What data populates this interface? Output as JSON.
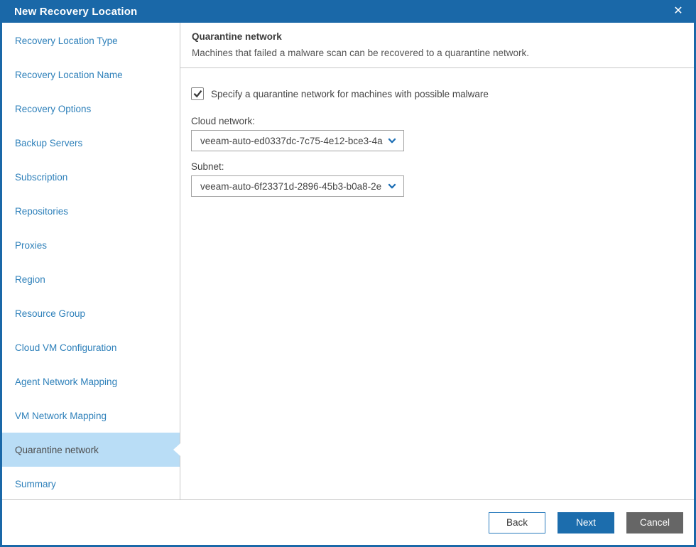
{
  "window": {
    "title": "New Recovery Location"
  },
  "icons": {
    "close_glyph": "✕",
    "chevron_down": "⌄",
    "checkmark": "✓"
  },
  "sidebar": {
    "items": [
      "Recovery Location Type",
      "Recovery Location Name",
      "Recovery Options",
      "Backup Servers",
      "Subscription",
      "Repositories",
      "Proxies",
      "Region",
      "Resource Group",
      "Cloud VM Configuration",
      "Agent Network Mapping",
      "VM Network Mapping",
      "Quarantine network",
      "Summary"
    ],
    "selected_index": 12,
    "selected_label": "Quarantine network"
  },
  "content": {
    "heading": "Quarantine network",
    "description": "Machines that failed a malware scan can be recovered to a quarantine network.",
    "checkbox": {
      "checked": true,
      "label": "Specify a quarantine network for machines with possible malware"
    },
    "cloud_network": {
      "label": "Cloud network:",
      "value": "veeam-auto-ed0337dc-7c75-4e12-bce3-4a"
    },
    "subnet": {
      "label": "Subnet:",
      "value": "veeam-auto-6f23371d-2896-45b3-b0a8-2e"
    }
  },
  "footer": {
    "back_label": "Back",
    "next_label": "Next",
    "cancel_label": "Cancel"
  },
  "colors": {
    "titlebar_blue": "#1a68a8",
    "primary_button_blue": "#1c6dad",
    "sidebar_link_blue": "#2e80ba",
    "selected_item_bg": "#b9ddf6",
    "cancel_gray": "#666666",
    "divider_gray": "#c8c8c8"
  }
}
